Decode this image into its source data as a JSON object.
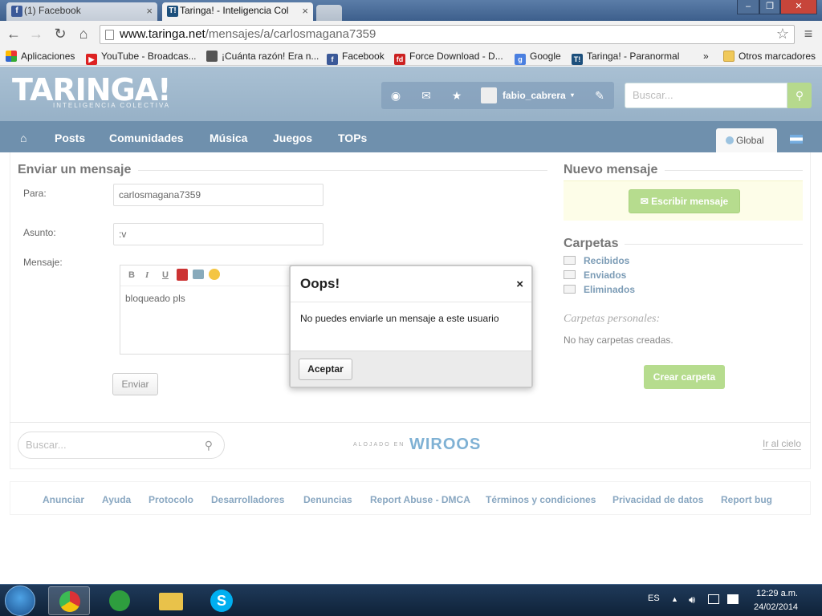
{
  "browser": {
    "tabs": [
      {
        "label": "(1) Facebook",
        "icon": "facebook-icon"
      },
      {
        "label": "Taringa! - Inteligencia Col",
        "icon": "taringa-icon"
      }
    ],
    "address": {
      "host": "www.taringa.net",
      "path": "/mensajes/a/carlosmagana7359"
    },
    "bookmarks": [
      {
        "label": "Aplicaciones",
        "icon": "apps-icon"
      },
      {
        "label": "YouTube - Broadcas...",
        "icon": "youtube-icon"
      },
      {
        "label": "¡Cuánta razón! Era n...",
        "icon": "cuanta-razon-icon"
      },
      {
        "label": "Facebook",
        "icon": "facebook-icon"
      },
      {
        "label": "Force Download - D...",
        "icon": "force-download-icon"
      },
      {
        "label": "Google",
        "icon": "google-icon"
      },
      {
        "label": "Taringa! - Paranormal",
        "icon": "taringa-icon"
      }
    ],
    "bookmarks_overflow": "»",
    "other_bookmarks": "Otros marcadores"
  },
  "site": {
    "logo": "TARINGA!",
    "logo_sub": "INTELIGENCIA COLECTIVA",
    "username": "fabio_cabrera",
    "search_placeholder": "Buscar...",
    "nav": [
      "Posts",
      "Comunidades",
      "Música",
      "Juegos",
      "TOPs"
    ],
    "global_tab": "Global"
  },
  "compose": {
    "title": "Enviar un mensaje",
    "to_label": "Para:",
    "to_value": "carlosmagana7359",
    "subject_label": "Asunto:",
    "subject_value": ":v",
    "message_label": "Mensaje:",
    "message_text": "bloqueado pls",
    "editor_tools": [
      "B",
      "I",
      "U"
    ],
    "send_label": "Enviar"
  },
  "sidebar": {
    "new_title": "Nuevo mensaje",
    "write_button": "Escribir mensaje",
    "folders_title": "Carpetas",
    "folders": [
      "Recibidos",
      "Enviados",
      "Eliminados"
    ],
    "personal_title": "Carpetas personales:",
    "personal_empty": "No hay carpetas creadas.",
    "create_button": "Crear carpeta"
  },
  "bottom": {
    "search_placeholder": "Buscar...",
    "hosted_label": "ALOJADO EN",
    "hosted_brand": "WIROOS",
    "top_link": "Ir al cielo"
  },
  "footer_links": [
    "Anunciar",
    "Ayuda",
    "Protocolo",
    "Desarrolladores",
    "Denuncias",
    "Report Abuse - DMCA",
    "Términos y condiciones",
    "Privacidad de datos",
    "Report bug"
  ],
  "modal": {
    "title": "Oops!",
    "close": "×",
    "message": "No puedes enviarle un mensaje a este usuario",
    "accept": "Aceptar"
  },
  "taskbar": {
    "lang": "ES",
    "time": "12:29 a.m.",
    "date": "24/02/2014"
  }
}
